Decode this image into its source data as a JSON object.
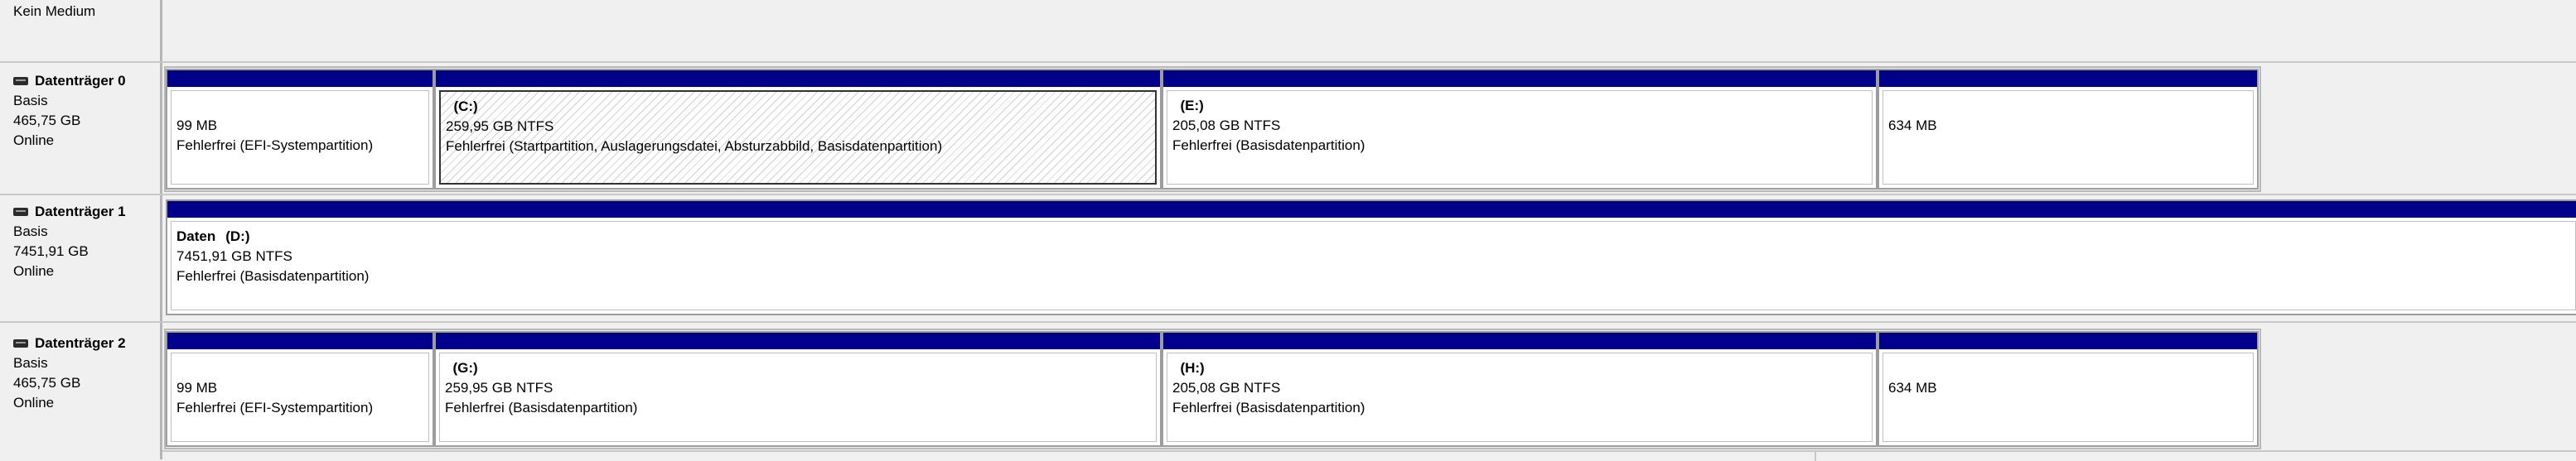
{
  "medium_row": {
    "label": "Kein Medium"
  },
  "disks": [
    {
      "name": "Datenträger 0",
      "type": "Basis",
      "size": "465,75 GB",
      "status": "Online",
      "partitions": [
        {
          "volume_label": "",
          "drive": "",
          "size": "99 MB",
          "status": "Fehlerfrei (EFI-Systempartition)",
          "selected": false
        },
        {
          "volume_label": "",
          "drive": "(C:)",
          "size": "259,95 GB NTFS",
          "status": "Fehlerfrei (Startpartition, Auslagerungsdatei, Absturzabbild, Basisdatenpartition)",
          "selected": true
        },
        {
          "volume_label": "",
          "drive": "(E:)",
          "size": "205,08 GB NTFS",
          "status": "Fehlerfrei (Basisdatenpartition)",
          "selected": false
        },
        {
          "volume_label": "",
          "drive": "",
          "size": "634 MB",
          "status": "",
          "selected": false
        }
      ]
    },
    {
      "name": "Datenträger 1",
      "type": "Basis",
      "size": "7451,91 GB",
      "status": "Online",
      "partitions": [
        {
          "volume_label": "Daten",
          "drive": "(D:)",
          "size": "7451,91 GB NTFS",
          "status": "Fehlerfrei (Basisdatenpartition)",
          "selected": false
        }
      ]
    },
    {
      "name": "Datenträger 2",
      "type": "Basis",
      "size": "465,75 GB",
      "status": "Online",
      "partitions": [
        {
          "volume_label": "",
          "drive": "",
          "size": "99 MB",
          "status": "Fehlerfrei (EFI-Systempartition)",
          "selected": false
        },
        {
          "volume_label": "",
          "drive": "(G:)",
          "size": "259,95 GB NTFS",
          "status": "Fehlerfrei (Basisdatenpartition)",
          "selected": false
        },
        {
          "volume_label": "",
          "drive": "(H:)",
          "size": "205,08 GB NTFS",
          "status": "Fehlerfrei (Basisdatenpartition)",
          "selected": false
        },
        {
          "volume_label": "",
          "drive": "",
          "size": "634 MB",
          "status": "",
          "selected": false
        }
      ]
    }
  ],
  "colors": {
    "partition_bar": "#00008b",
    "background": "#f0f0f0"
  }
}
